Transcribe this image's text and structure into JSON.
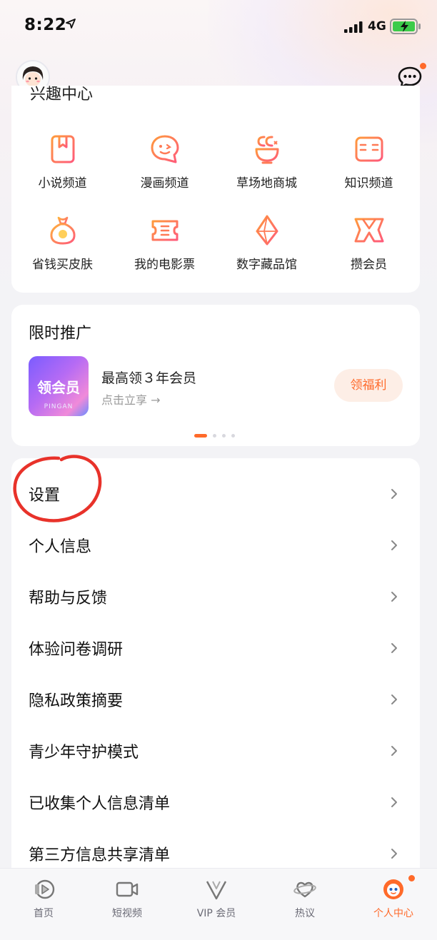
{
  "status_bar": {
    "time": "8:22",
    "network": "4G"
  },
  "header": {
    "section_title_partial": "兴趣中心"
  },
  "fun_center": {
    "items": [
      {
        "label": "小说频道",
        "icon": "book-icon"
      },
      {
        "label": "漫画频道",
        "icon": "comic-face-icon"
      },
      {
        "label": "草场地商城",
        "icon": "shop-cc-icon"
      },
      {
        "label": "知识频道",
        "icon": "open-book-icon"
      },
      {
        "label": "省钱买皮肤",
        "icon": "money-bag-icon"
      },
      {
        "label": "我的电影票",
        "icon": "ticket-icon"
      },
      {
        "label": "数字藏品馆",
        "icon": "crystal-icon"
      },
      {
        "label": "攒会员",
        "icon": "vip-ribbon-icon"
      }
    ]
  },
  "promo": {
    "title": "限时推广",
    "image_text": "领会员",
    "image_brand": "PINGAN",
    "main_text": "最高领３年会员",
    "sub_text": "点击立享 →",
    "button_label": "领福利"
  },
  "menu": {
    "items": [
      "设置",
      "个人信息",
      "帮助与反馈",
      "体验问卷调研",
      "隐私政策摘要",
      "青少年守护模式",
      "已收集个人信息清单",
      "第三方信息共享清单"
    ]
  },
  "tabbar": {
    "tabs": [
      {
        "label": "首页",
        "icon": "home-play-icon"
      },
      {
        "label": "短视频",
        "icon": "video-camera-icon"
      },
      {
        "label": "VIP 会员",
        "icon": "vip-icon"
      },
      {
        "label": "热议",
        "icon": "planet-icon"
      },
      {
        "label": "个人中心",
        "icon": "profile-face-icon"
      }
    ],
    "active_tab": "个人中心"
  },
  "colors": {
    "accent": "#ff6a2a",
    "annotation": "#e8322a",
    "icon_gradient": [
      "#ff9a3c",
      "#ff5a7a"
    ]
  }
}
